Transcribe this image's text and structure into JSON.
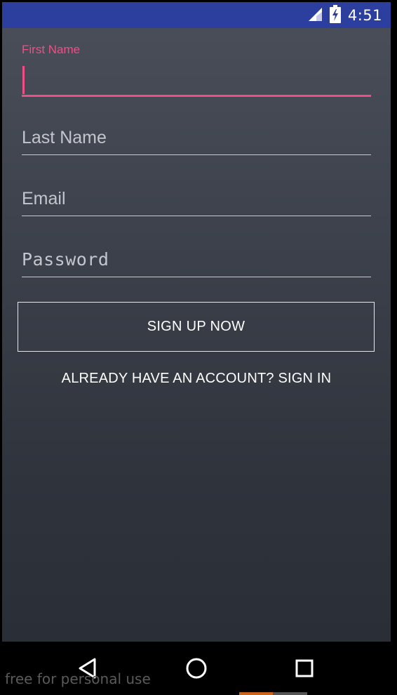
{
  "status_bar": {
    "time": "4:51",
    "color": "#2c3e9e",
    "icons": [
      "signal-icon",
      "battery-charging-icon"
    ]
  },
  "form": {
    "first_name": {
      "label": "First Name",
      "value": ""
    },
    "last_name": {
      "placeholder": "Last Name",
      "value": ""
    },
    "email": {
      "placeholder": "Email",
      "value": ""
    },
    "password": {
      "placeholder": "Password",
      "value": ""
    }
  },
  "actions": {
    "signup_label": "SIGN UP NOW",
    "signin_label": "ALREADY HAVE AN ACCOUNT? SIGN IN"
  },
  "nav_bar": {
    "icons": [
      "back-icon",
      "home-icon",
      "recents-icon"
    ]
  },
  "watermark": "free for personal use",
  "colors": {
    "accent": "#ef4f86",
    "background": "#3d424c"
  }
}
